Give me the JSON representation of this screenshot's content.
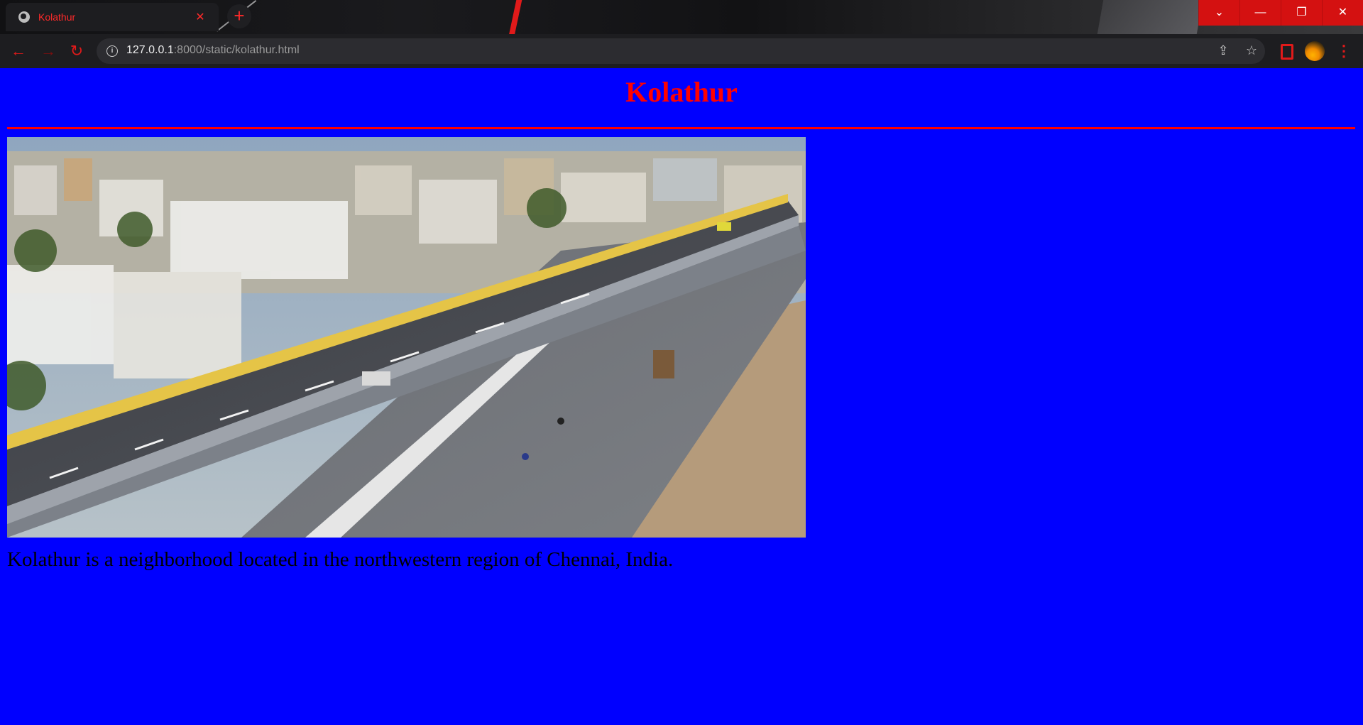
{
  "browser": {
    "tab_title": "Kolathur",
    "tab_close_glyph": "✕",
    "new_tab_glyph": "+",
    "url_host": "127.0.0.1",
    "url_rest": ":8000/static/kolathur.html",
    "nav": {
      "back_glyph": "←",
      "forward_glyph": "→",
      "reload_glyph": "↻"
    },
    "window_controls": {
      "tab_search_glyph": "⌄",
      "minimize_glyph": "—",
      "restore_glyph": "❐",
      "close_glyph": "✕"
    },
    "omnibox_icons": {
      "info_glyph": "i",
      "share_glyph": "⇪",
      "star_glyph": "☆"
    },
    "menu_glyph": "⋮",
    "accent_color": "#e01a1a"
  },
  "page": {
    "title": "Kolathur",
    "image_subject": "aerial view of a flyover highway in Kolathur",
    "description": "Kolathur is a neighborhood located in the northwestern region of Chennai, India.",
    "background_color": "#0000ff",
    "title_color": "#ff0000",
    "rule_color": "#ff0000"
  }
}
